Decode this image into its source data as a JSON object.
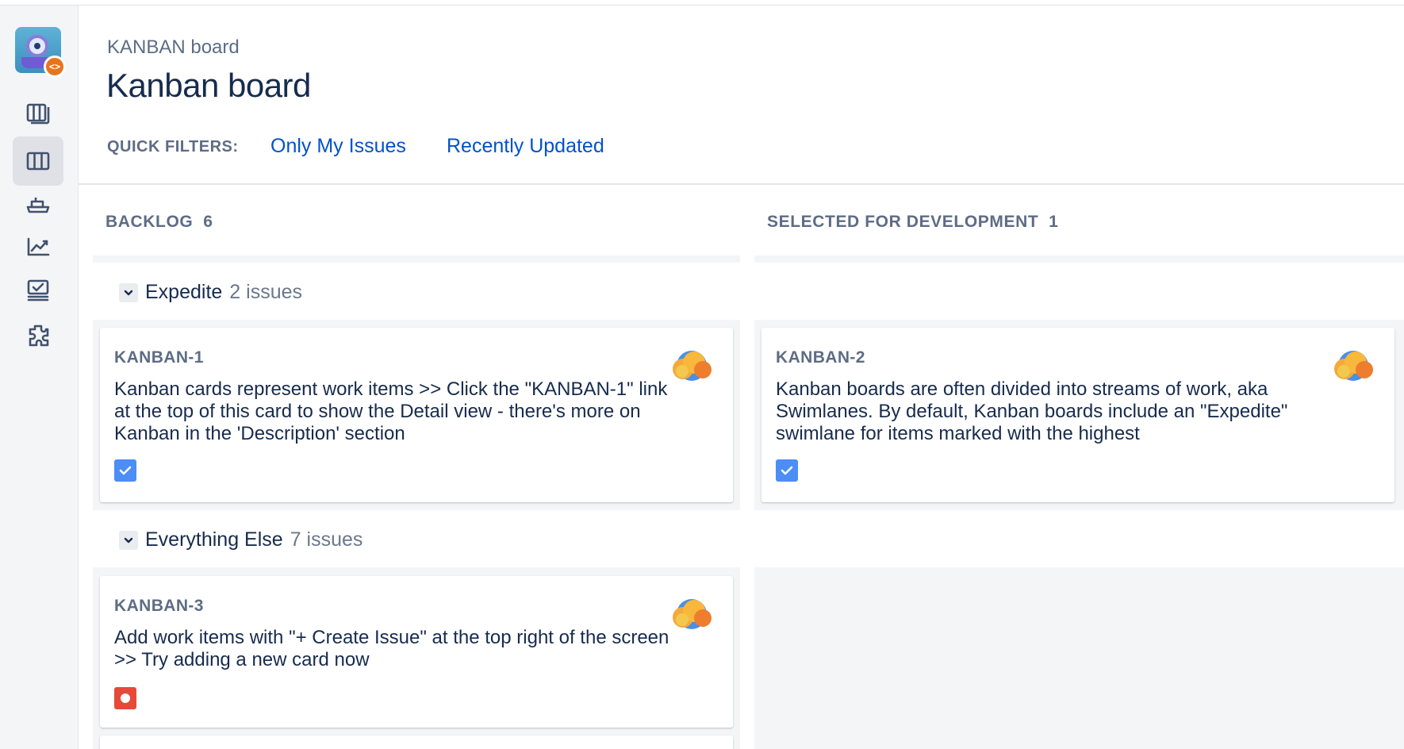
{
  "sidebar": {
    "project_badge": "<>",
    "items": [
      {
        "icon": "backlog-icon"
      },
      {
        "icon": "board-icon",
        "active": true
      },
      {
        "icon": "releases-icon"
      },
      {
        "icon": "reports-icon"
      },
      {
        "icon": "issues-icon"
      },
      {
        "icon": "addons-icon"
      }
    ]
  },
  "header": {
    "breadcrumb": "KANBAN board",
    "title": "Kanban board",
    "quick_filters_label": "QUICK FILTERS:",
    "quick_filters": [
      "Only My Issues",
      "Recently Updated"
    ]
  },
  "columns": [
    {
      "name": "BACKLOG",
      "count": "6"
    },
    {
      "name": "SELECTED FOR DEVELOPMENT",
      "count": "1"
    }
  ],
  "swimlanes": [
    {
      "name": "Expedite",
      "count": "2 issues"
    },
    {
      "name": "Everything Else",
      "count": "7 issues"
    }
  ],
  "cards": [
    {
      "key": "KANBAN-1",
      "summary": "Kanban cards represent work items >> Click the \"KANBAN-1\" link at the top of this card to show the Detail view - there's more on Kanban in the 'Description' section",
      "type": "task",
      "avatar": "cloud-avatar-icon"
    },
    {
      "key": "KANBAN-2",
      "summary": "Kanban boards are often divided into streams of work, aka Swimlanes. By default, Kanban boards include an \"Expedite\" swimlane for items marked with the highest",
      "type": "task",
      "avatar": "cloud-avatar-icon"
    },
    {
      "key": "KANBAN-3",
      "summary": "Add work items with \"+ Create Issue\" at the top right of the screen >> Try adding a new card now",
      "type": "bug",
      "avatar": "cloud-avatar-icon"
    }
  ],
  "colors": {
    "link": "#0052cc",
    "sidebar_bg": "#f4f5f7",
    "task_icon": "#4c8df6",
    "bug_icon": "#e5493a",
    "muted_text": "#5e6c84"
  }
}
